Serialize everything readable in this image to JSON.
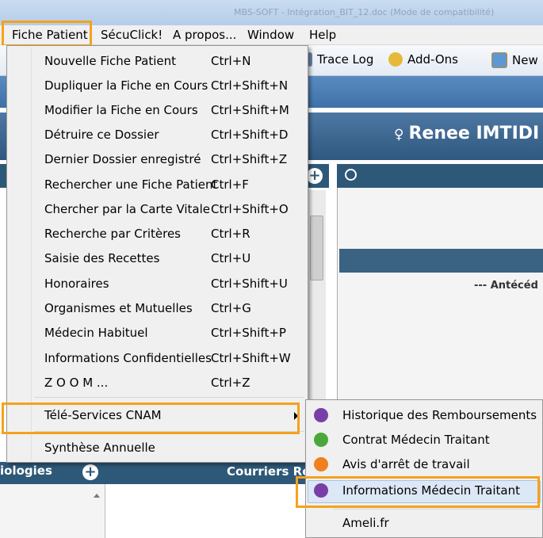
{
  "window": {
    "title": "MBS-SOFT - Intégration_BIT_12.doc (Mode de compatibilité)"
  },
  "menubar": {
    "items": [
      "Fiche Patient",
      "SécuClick!",
      "A propos...",
      "Window",
      "Help"
    ]
  },
  "toolbar": {
    "items": [
      {
        "label": "Trace Log",
        "icon": "trace-log-icon"
      },
      {
        "label": "Add-Ons",
        "icon": "add-ons-icon"
      },
      {
        "label": "New",
        "icon": "new-icon"
      }
    ]
  },
  "patient": {
    "name": "Renee IMTIDI",
    "sex_icon": "female-symbol-icon"
  },
  "panels": {
    "antecedents_label": "--- Antécéd",
    "bottom_left_label": "iologies",
    "bottom_mid_label": "Courriers Re"
  },
  "fiche_menu": {
    "items": [
      {
        "label": "Nouvelle Fiche Patient",
        "shortcut": "Ctrl+N"
      },
      {
        "label": "Dupliquer la Fiche en Cours",
        "shortcut": "Ctrl+Shift+N"
      },
      {
        "label": "Modifier la Fiche en Cours",
        "shortcut": "Ctrl+Shift+M"
      },
      {
        "label": "Détruire ce Dossier",
        "shortcut": "Ctrl+Shift+D"
      },
      {
        "label": "Dernier Dossier enregistré",
        "shortcut": "Ctrl+Shift+Z"
      },
      {
        "label": "Rechercher une Fiche Patient",
        "shortcut": "Ctrl+F"
      },
      {
        "label": "Chercher par la Carte Vitale",
        "shortcut": "Ctrl+Shift+O"
      },
      {
        "label": "Recherche par Critères",
        "shortcut": "Ctrl+R"
      },
      {
        "label": "Saisie des Recettes",
        "shortcut": "Ctrl+U"
      },
      {
        "label": "Honoraires",
        "shortcut": "Ctrl+Shift+U"
      },
      {
        "label": "Organismes et Mutuelles",
        "shortcut": "Ctrl+G"
      },
      {
        "label": "Médecin Habituel",
        "shortcut": "Ctrl+Shift+P"
      },
      {
        "label": "Informations Confidentielles",
        "shortcut": "Ctrl+Shift+W"
      },
      {
        "label": "Z O O M ...",
        "shortcut": "Ctrl+Z"
      }
    ],
    "tele_services": "Télé-Services CNAM",
    "synthese": "Synthèse Annuelle"
  },
  "tele_submenu": {
    "items": [
      {
        "label": "Historique des Remboursements",
        "color": "#7a3fa6"
      },
      {
        "label": "Contrat Médecin Traitant",
        "color": "#4aa83a"
      },
      {
        "label": "Avis d'arrêt de travail",
        "color": "#f07f1e"
      },
      {
        "label": "Informations Médecin Traitant",
        "color": "#7a3fa6"
      }
    ],
    "ameli": "Ameli.fr"
  },
  "colors": {
    "highlight": "#f5a21b",
    "header_blue": "#2e5878"
  }
}
